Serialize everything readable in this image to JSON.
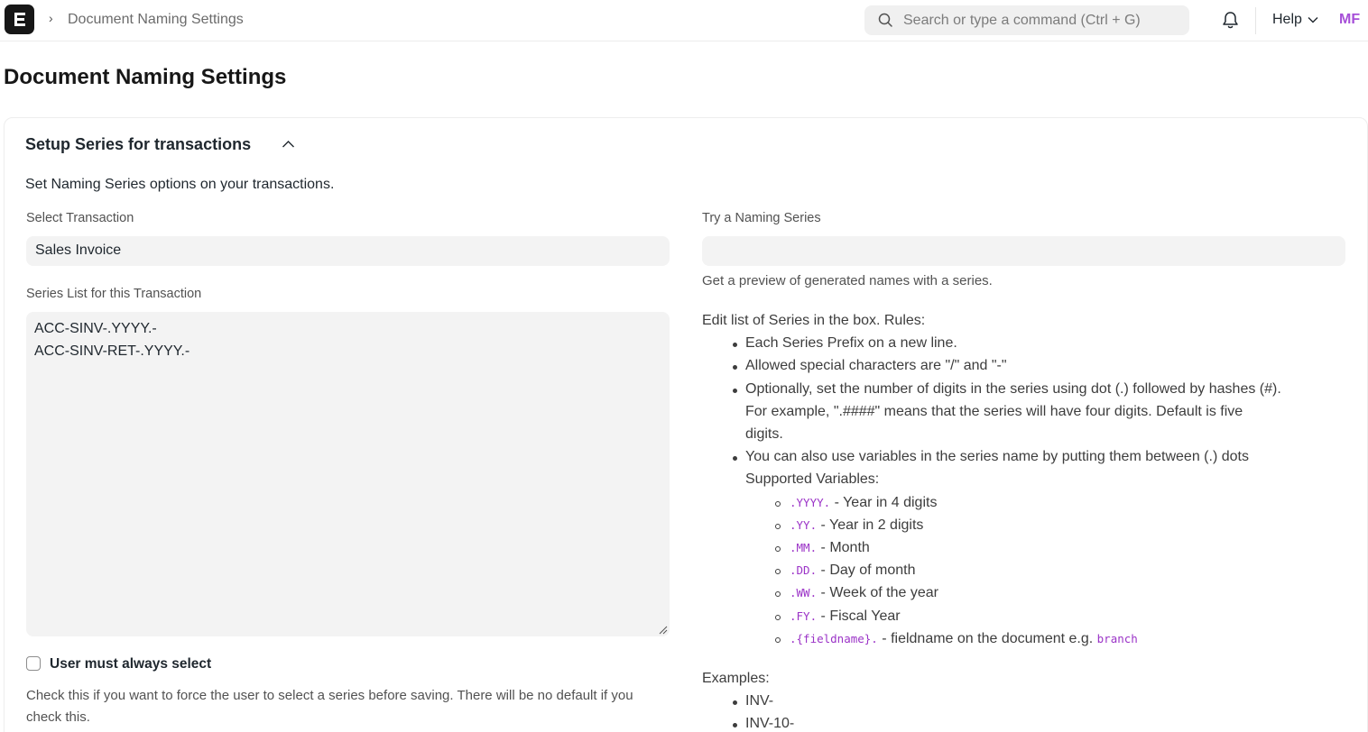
{
  "navbar": {
    "breadcrumb": "Document Naming Settings",
    "search_placeholder": "Search or type a command (Ctrl + G)",
    "help_label": "Help",
    "avatar_initials": "MF",
    "avatar_color": "#a64fd8",
    "icons": [
      "app-logo-icon",
      "chevron-right-icon",
      "search-icon",
      "bell-icon",
      "chevron-down-icon"
    ]
  },
  "page": {
    "title": "Document Naming Settings"
  },
  "section": {
    "title": "Setup Series for transactions",
    "description": "Set Naming Series options on your transactions.",
    "select_transaction_label": "Select Transaction",
    "select_transaction_value": "Sales Invoice",
    "series_list_label": "Series List for this Transaction",
    "series_list_lines": [
      "ACC-SINV-.YYYY.-",
      "ACC-SINV-RET-.YYYY.-"
    ],
    "user_must_select_label": "User must always select",
    "user_must_select_checked": false,
    "user_must_select_help": "Check this if you want to force the user to select a series before saving. There will be no default if you check this.",
    "try_series_label": "Try a Naming Series",
    "try_series_value": "",
    "preview_note": "Get a preview of generated names with a series.",
    "rules_intro": "Edit list of Series in the box. Rules:",
    "rules": [
      "Each Series Prefix on a new line.",
      "Allowed special characters are \"/\" and \"-\"",
      "Optionally, set the number of digits in the series using dot (.) followed by hashes (#).",
      "For example, \".####\" means that the series will have four digits. Default is five",
      "digits.",
      "You can also use variables in the series name by putting them between (.) dots",
      "Supported Variables:"
    ],
    "variables": [
      {
        "code": ".YYYY.",
        "desc": " - Year in 4 digits"
      },
      {
        "code": ".YY.",
        "desc": " - Year in 2 digits"
      },
      {
        "code": ".MM.",
        "desc": " - Month"
      },
      {
        "code": ".DD.",
        "desc": " - Day of month"
      },
      {
        "code": ".WW.",
        "desc": " - Week of the year"
      },
      {
        "code": ".FY.",
        "desc": " - Fiscal Year"
      },
      {
        "code": ".{fieldname}.",
        "desc": " - fieldname on the document e.g. ",
        "example": "branch"
      }
    ],
    "examples_label": "Examples:",
    "examples": [
      "INV-",
      "INV-10-"
    ]
  }
}
